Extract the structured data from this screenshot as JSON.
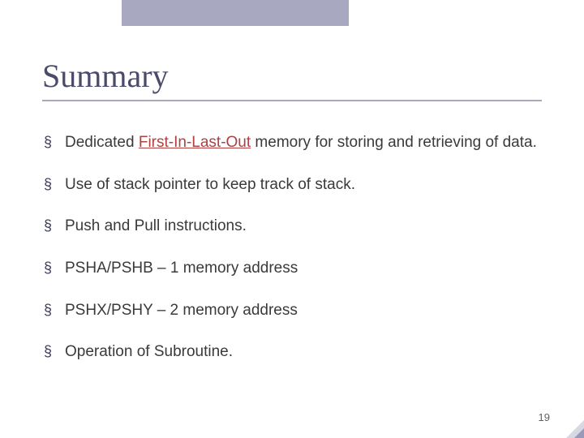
{
  "title": "Summary",
  "bullets": [
    {
      "pre": "Dedicated ",
      "hl": "First-In-Last-Out",
      "post": " memory for storing and retrieving of data."
    },
    {
      "pre": "Use of stack pointer to keep track of stack.",
      "hl": "",
      "post": ""
    },
    {
      "pre": "Push and Pull instructions.",
      "hl": "",
      "post": ""
    },
    {
      "pre": "PSHA/PSHB – 1 memory address",
      "hl": "",
      "post": ""
    },
    {
      "pre": "PSHX/PSHY – 2 memory address",
      "hl": "",
      "post": ""
    },
    {
      "pre": "Operation of Subroutine.",
      "hl": "",
      "post": ""
    }
  ],
  "page_number": "19"
}
